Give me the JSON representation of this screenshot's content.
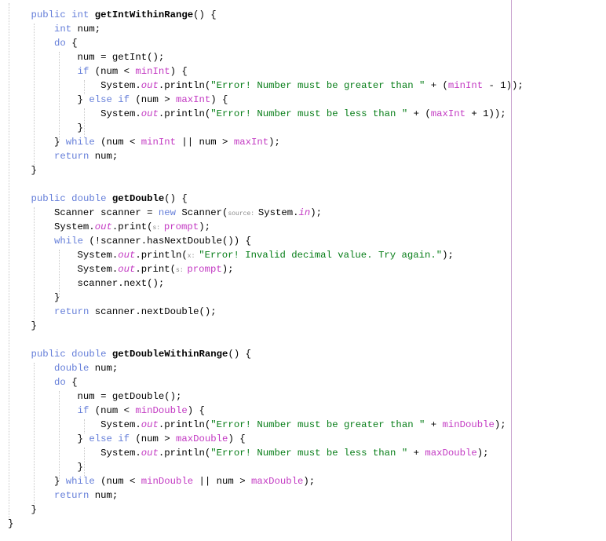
{
  "editor": {
    "lines": [
      [
        {
          "t": "    "
        },
        {
          "t": "public int ",
          "c": "kw"
        },
        {
          "t": "getIntWithinRange",
          "c": "fn"
        },
        {
          "t": "() {"
        }
      ],
      [
        {
          "t": "        "
        },
        {
          "t": "int ",
          "c": "kw"
        },
        {
          "t": "num;"
        }
      ],
      [
        {
          "t": "        "
        },
        {
          "t": "do ",
          "c": "kw"
        },
        {
          "t": "{"
        }
      ],
      [
        {
          "t": "            num = getInt();"
        }
      ],
      [
        {
          "t": "            "
        },
        {
          "t": "if ",
          "c": "kw"
        },
        {
          "t": "(num < "
        },
        {
          "t": "minInt",
          "c": "fld"
        },
        {
          "t": ") {"
        }
      ],
      [
        {
          "t": "                System."
        },
        {
          "t": "out",
          "c": "st"
        },
        {
          "t": ".println("
        },
        {
          "t": "\"Error! Number must be greater than \"",
          "c": "str"
        },
        {
          "t": " + ("
        },
        {
          "t": "minInt",
          "c": "fld"
        },
        {
          "t": " - 1));"
        }
      ],
      [
        {
          "t": "            } "
        },
        {
          "t": "else if ",
          "c": "kw"
        },
        {
          "t": "(num > "
        },
        {
          "t": "maxInt",
          "c": "fld"
        },
        {
          "t": ") {"
        }
      ],
      [
        {
          "t": "                System."
        },
        {
          "t": "out",
          "c": "st"
        },
        {
          "t": ".println("
        },
        {
          "t": "\"Error! Number must be less than \"",
          "c": "str"
        },
        {
          "t": " + ("
        },
        {
          "t": "maxInt",
          "c": "fld"
        },
        {
          "t": " + 1));"
        }
      ],
      [
        {
          "t": "            }"
        }
      ],
      [
        {
          "t": "        } "
        },
        {
          "t": "while ",
          "c": "kw"
        },
        {
          "t": "(num < "
        },
        {
          "t": "minInt",
          "c": "fld"
        },
        {
          "t": " || num > "
        },
        {
          "t": "maxInt",
          "c": "fld"
        },
        {
          "t": ");"
        }
      ],
      [
        {
          "t": "        "
        },
        {
          "t": "return ",
          "c": "kw"
        },
        {
          "t": "num;"
        }
      ],
      [
        {
          "t": "    }"
        }
      ],
      [
        {
          "t": ""
        }
      ],
      [
        {
          "t": "    "
        },
        {
          "t": "public double ",
          "c": "kw"
        },
        {
          "t": "getDouble",
          "c": "fn"
        },
        {
          "t": "() {"
        }
      ],
      [
        {
          "t": "        Scanner scanner = "
        },
        {
          "t": "new ",
          "c": "kw"
        },
        {
          "t": "Scanner("
        },
        {
          "t": "source: ",
          "c": "hint"
        },
        {
          "t": "System."
        },
        {
          "t": "in",
          "c": "st"
        },
        {
          "t": ");"
        }
      ],
      [
        {
          "t": "        System."
        },
        {
          "t": "out",
          "c": "st"
        },
        {
          "t": ".print("
        },
        {
          "t": "s: ",
          "c": "hint"
        },
        {
          "t": "prompt",
          "c": "fld"
        },
        {
          "t": ");"
        }
      ],
      [
        {
          "t": "        "
        },
        {
          "t": "while ",
          "c": "kw"
        },
        {
          "t": "(!scanner.hasNextDouble()) {"
        }
      ],
      [
        {
          "t": "            System."
        },
        {
          "t": "out",
          "c": "st"
        },
        {
          "t": ".println("
        },
        {
          "t": "x: ",
          "c": "hint"
        },
        {
          "t": "\"Error! Invalid decimal value. Try again.\"",
          "c": "str"
        },
        {
          "t": ");"
        }
      ],
      [
        {
          "t": "            System."
        },
        {
          "t": "out",
          "c": "st"
        },
        {
          "t": ".print("
        },
        {
          "t": "s: ",
          "c": "hint"
        },
        {
          "t": "prompt",
          "c": "fld"
        },
        {
          "t": ");"
        }
      ],
      [
        {
          "t": "            scanner.next();"
        }
      ],
      [
        {
          "t": "        }"
        }
      ],
      [
        {
          "t": "        "
        },
        {
          "t": "return ",
          "c": "kw"
        },
        {
          "t": "scanner.nextDouble();"
        }
      ],
      [
        {
          "t": "    }"
        }
      ],
      [
        {
          "t": ""
        }
      ],
      [
        {
          "t": "    "
        },
        {
          "t": "public double ",
          "c": "kw"
        },
        {
          "t": "getDoubleWithinRange",
          "c": "fn"
        },
        {
          "t": "() {"
        }
      ],
      [
        {
          "t": "        "
        },
        {
          "t": "double ",
          "c": "kw"
        },
        {
          "t": "num;"
        }
      ],
      [
        {
          "t": "        "
        },
        {
          "t": "do ",
          "c": "kw"
        },
        {
          "t": "{"
        }
      ],
      [
        {
          "t": "            num = getDouble();"
        }
      ],
      [
        {
          "t": "            "
        },
        {
          "t": "if ",
          "c": "kw"
        },
        {
          "t": "(num < "
        },
        {
          "t": "minDouble",
          "c": "fld"
        },
        {
          "t": ") {"
        }
      ],
      [
        {
          "t": "                System."
        },
        {
          "t": "out",
          "c": "st"
        },
        {
          "t": ".println("
        },
        {
          "t": "\"Error! Number must be greater than \"",
          "c": "str"
        },
        {
          "t": " + "
        },
        {
          "t": "minDouble",
          "c": "fld"
        },
        {
          "t": ");"
        }
      ],
      [
        {
          "t": "            } "
        },
        {
          "t": "else if ",
          "c": "kw"
        },
        {
          "t": "(num > "
        },
        {
          "t": "maxDouble",
          "c": "fld"
        },
        {
          "t": ") {"
        }
      ],
      [
        {
          "t": "                System."
        },
        {
          "t": "out",
          "c": "st"
        },
        {
          "t": ".println("
        },
        {
          "t": "\"Error! Number must be less than \"",
          "c": "str"
        },
        {
          "t": " + "
        },
        {
          "t": "maxDouble",
          "c": "fld"
        },
        {
          "t": ");"
        }
      ],
      [
        {
          "t": "            }"
        }
      ],
      [
        {
          "t": "        } "
        },
        {
          "t": "while ",
          "c": "kw"
        },
        {
          "t": "(num < "
        },
        {
          "t": "minDouble",
          "c": "fld"
        },
        {
          "t": " || num > "
        },
        {
          "t": "maxDouble",
          "c": "fld"
        },
        {
          "t": ");"
        }
      ],
      [
        {
          "t": "        "
        },
        {
          "t": "return ",
          "c": "kw"
        },
        {
          "t": "num;"
        }
      ],
      [
        {
          "t": "    }"
        }
      ],
      [
        {
          "t": "}"
        }
      ]
    ]
  }
}
